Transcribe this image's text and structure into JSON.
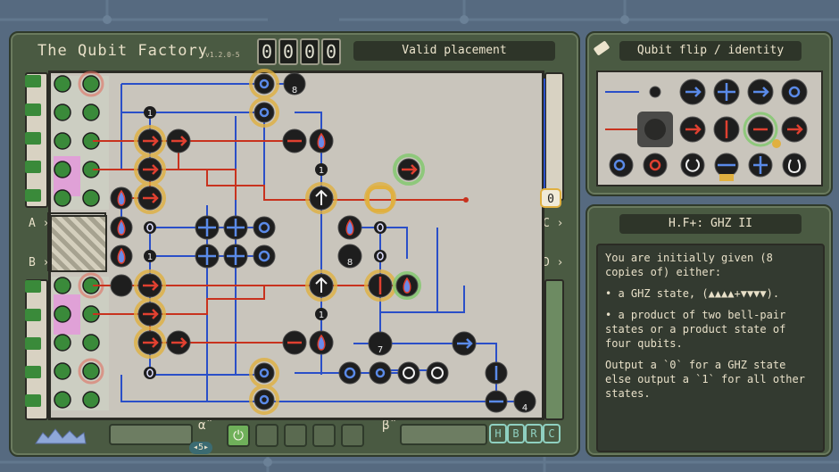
{
  "game": {
    "title": "The Qubit Factory",
    "version": "v1.2.0-5",
    "counter": [
      "0",
      "0",
      "0",
      "0"
    ],
    "status": "Valid placement"
  },
  "board": {
    "left_labels": [
      "A",
      "B"
    ],
    "right_labels": [
      "C",
      "D"
    ],
    "output_value": "0",
    "gate_numbers": [
      "8",
      "1",
      "1",
      "1",
      "8",
      "1",
      "7",
      "4"
    ]
  },
  "controls": {
    "alpha": "α̂",
    "beta": "β̂",
    "speed": "5",
    "power_label": "⏻",
    "buttons": [
      "H",
      "B",
      "R",
      "C"
    ]
  },
  "tools": {
    "title": "Qubit flip / identity"
  },
  "info": {
    "title": "H.F+: GHZ II",
    "paragraphs": [
      "You are initially given (8 copies of) either:",
      "• a GHZ state, (▲▲▲▲+▼▼▼▼).",
      "• a product of two bell-pair states or a product state of four qubits.",
      "Output a `0` for a GHZ state else output a `1` for all other states."
    ]
  },
  "colors": {
    "background": "#566a80",
    "panel": "#4a5a42",
    "board": "#c9c5bc",
    "wire_blue": "#2a4fc8",
    "wire_red": "#c8321e",
    "gate_black": "#1e1e1e",
    "halo_orange": "#e0b040",
    "halo_green": "#7fc86a",
    "text_cream": "#e8e0c8"
  }
}
